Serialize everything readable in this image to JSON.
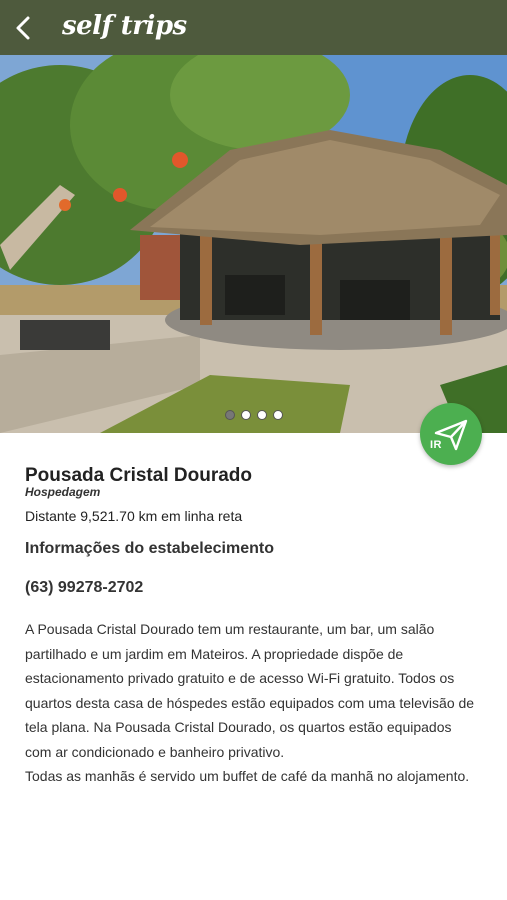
{
  "header": {
    "brand": "self trips",
    "back_icon": "chevron-left-icon",
    "background_color": "#4e5a3d"
  },
  "gallery": {
    "page_count": 4,
    "active_page": 1
  },
  "actions": {
    "go_label": "IR",
    "go_icon": "paper-plane-icon",
    "go_color": "#4caf50"
  },
  "place": {
    "name": "Pousada Cristal Dourado",
    "category": "Hospedagem",
    "distance": "Distante 9,521.70 km em linha reta"
  },
  "info": {
    "section_title": "Informações do estabelecimento",
    "phone": "(63) 99278-2702",
    "description": "A Pousada Cristal Dourado tem um restaurante, um bar, um salão partilhado e um jardim em Mateiros. A propriedade dispõe de estacionamento privado gratuito e de acesso Wi-Fi gratuito. Todos os quartos desta casa de hóspedes estão equipados com uma televisão de tela plana. Na Pousada Cristal Dourado, os quartos estão equipados com ar condicionado e banheiro privativo.\nTodas as manhãs é servido um buffet de café da manhã no alojamento."
  }
}
